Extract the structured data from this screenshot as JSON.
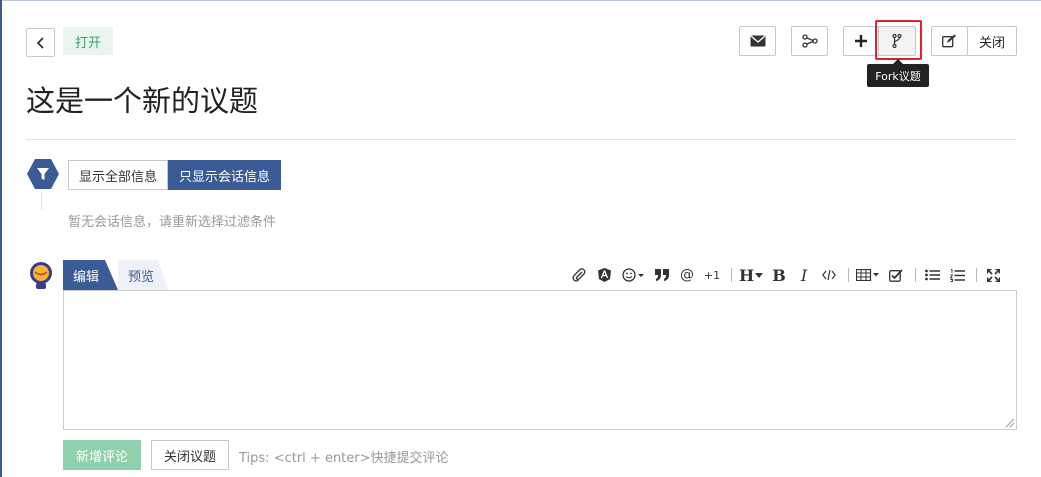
{
  "header": {
    "status_badge": "打开",
    "close_label": "关闭",
    "tooltip": "Fork议题"
  },
  "page": {
    "title": "这是一个新的议题"
  },
  "filter": {
    "show_all_label": "显示全部信息",
    "show_conversation_label": "只显示会话信息",
    "empty_message": "暂无会话信息，请重新选择过滤条件"
  },
  "editor": {
    "tab_edit": "编辑",
    "tab_preview": "预览",
    "plus_one_label": "+1",
    "heading_label": "H",
    "bold_label": "B",
    "italic_label": "I",
    "value": ""
  },
  "footer": {
    "submit_label": "新增评论",
    "close_issue_label": "关闭议题",
    "tips": "Tips: <ctrl + enter>快捷提交评论"
  },
  "colors": {
    "accent": "#3b5b96",
    "status_green": "#37a06a",
    "submit_disabled": "#8fd1ad",
    "highlight": "#e0242b"
  },
  "icons": [
    "chevron-left-icon",
    "mail-icon",
    "share-icon",
    "plus-icon",
    "fork-icon",
    "edit-icon",
    "filter-icon",
    "avatar-icon",
    "paperclip-icon",
    "angular-icon",
    "smiley-icon",
    "quote-icon",
    "at-icon",
    "heading-icon",
    "bold-icon",
    "italic-icon",
    "code-icon",
    "table-icon",
    "checkbox-icon",
    "bullet-list-icon",
    "numbered-list-icon",
    "fullscreen-icon",
    "resize-grip-icon"
  ]
}
